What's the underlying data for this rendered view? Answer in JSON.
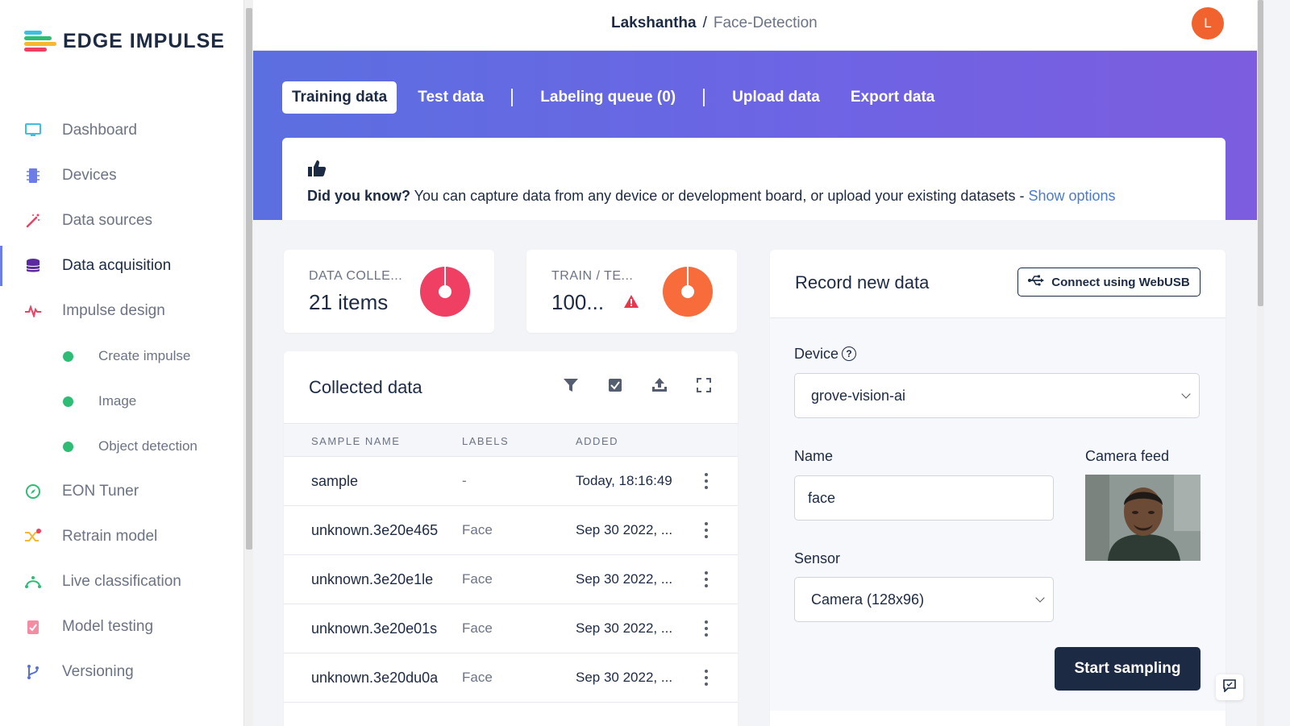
{
  "brand": {
    "name": "EDGE IMPULSE"
  },
  "sidebar": {
    "items": [
      {
        "label": "Dashboard",
        "icon": "monitor-icon"
      },
      {
        "label": "Devices",
        "icon": "chip-icon"
      },
      {
        "label": "Data sources",
        "icon": "magic-wand-icon"
      },
      {
        "label": "Data acquisition",
        "icon": "database-icon",
        "active": true
      },
      {
        "label": "Impulse design",
        "icon": "pulse-icon"
      },
      {
        "label": "Create impulse",
        "sub": true
      },
      {
        "label": "Image",
        "sub": true
      },
      {
        "label": "Object detection",
        "sub": true
      },
      {
        "label": "EON Tuner",
        "icon": "compass-icon"
      },
      {
        "label": "Retrain model",
        "icon": "shuffle-icon"
      },
      {
        "label": "Live classification",
        "icon": "live-icon"
      },
      {
        "label": "Model testing",
        "icon": "clipboard-check-icon"
      },
      {
        "label": "Versioning",
        "icon": "branch-icon"
      }
    ]
  },
  "header": {
    "user": "Lakshantha",
    "separator": "/",
    "project": "Face-Detection",
    "avatar_initial": "L"
  },
  "tabs": [
    {
      "label": "Training data",
      "active": true
    },
    {
      "label": "Test data"
    },
    {
      "label": "Labeling queue (0)"
    },
    {
      "label": "Upload data"
    },
    {
      "label": "Export data"
    }
  ],
  "tip": {
    "bold": "Did you know?",
    "text": " You can capture data from any device or development board, or upload your existing datasets - ",
    "link": "Show options"
  },
  "stats": {
    "collected": {
      "title": "DATA COLLE...",
      "value": "21 items",
      "color": "#ef3f63"
    },
    "split": {
      "title": "TRAIN / TE...",
      "value": "100...",
      "color": "#f86b3a",
      "warning_color": "#e8364d"
    }
  },
  "collected_data": {
    "title": "Collected data",
    "columns": [
      "SAMPLE NAME",
      "LABELS",
      "ADDED"
    ],
    "rows": [
      {
        "name": "sample",
        "label": "-",
        "added": "Today, 18:16:49"
      },
      {
        "name": "unknown.3e20e465",
        "label": "Face",
        "added": "Sep 30 2022, ..."
      },
      {
        "name": "unknown.3e20e1le",
        "label": "Face",
        "added": "Sep 30 2022, ..."
      },
      {
        "name": "unknown.3e20e01s",
        "label": "Face",
        "added": "Sep 30 2022, ..."
      },
      {
        "name": "unknown.3e20du0a",
        "label": "Face",
        "added": "Sep 30 2022, ..."
      }
    ]
  },
  "record": {
    "title": "Record new data",
    "webusb_label": "Connect using WebUSB",
    "device_label": "Device",
    "device_value": "grove-vision-ai",
    "name_label": "Name",
    "name_value": "face",
    "camera_label": "Camera feed",
    "sensor_label": "Sensor",
    "sensor_value": "Camera (128x96)",
    "start_label": "Start sampling"
  },
  "colors": {
    "accent": "#5b6fe0",
    "navy": "#1c2a44",
    "green": "#2dbd74"
  }
}
